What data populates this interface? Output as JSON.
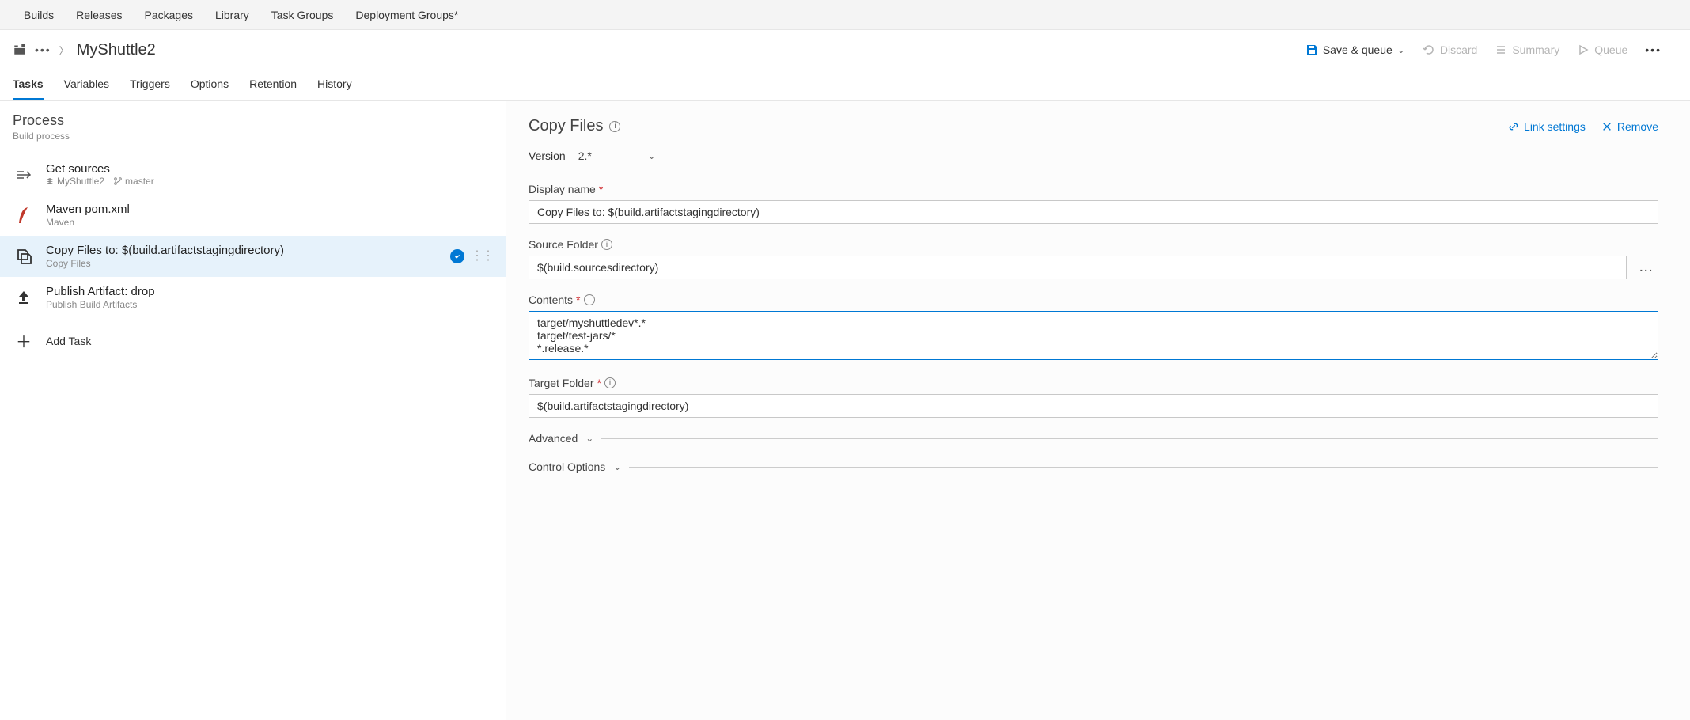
{
  "topnav": [
    "Builds",
    "Releases",
    "Packages",
    "Library",
    "Task Groups",
    "Deployment Groups*"
  ],
  "breadcrumb": {
    "title": "MyShuttle2"
  },
  "actions": {
    "save_queue": "Save & queue",
    "discard": "Discard",
    "summary": "Summary",
    "queue": "Queue"
  },
  "subtabs": [
    "Tasks",
    "Variables",
    "Triggers",
    "Options",
    "Retention",
    "History"
  ],
  "process": {
    "title": "Process",
    "desc": "Build process"
  },
  "tasks": {
    "get_sources": {
      "title": "Get sources",
      "repo": "MyShuttle2",
      "branch": "master"
    },
    "maven": {
      "title": "Maven pom.xml",
      "sub": "Maven"
    },
    "copy": {
      "title": "Copy Files to: $(build.artifactstagingdirectory)",
      "sub": "Copy Files"
    },
    "publish": {
      "title": "Publish Artifact: drop",
      "sub": "Publish Build Artifacts"
    },
    "add_task": "Add Task"
  },
  "detail": {
    "title": "Copy Files",
    "link_settings": "Link settings",
    "remove": "Remove",
    "version_label": "Version",
    "version_value": "2.*",
    "display_name_label": "Display name",
    "display_name_value": "Copy Files to: $(build.artifactstagingdirectory)",
    "source_folder_label": "Source Folder",
    "source_folder_value": "$(build.sourcesdirectory)",
    "contents_label": "Contents",
    "contents_value": "target/myshuttledev*.*\ntarget/test-jars/*\n*.release.*",
    "target_folder_label": "Target Folder",
    "target_folder_value": "$(build.artifactstagingdirectory)",
    "advanced": "Advanced",
    "control_options": "Control Options"
  }
}
